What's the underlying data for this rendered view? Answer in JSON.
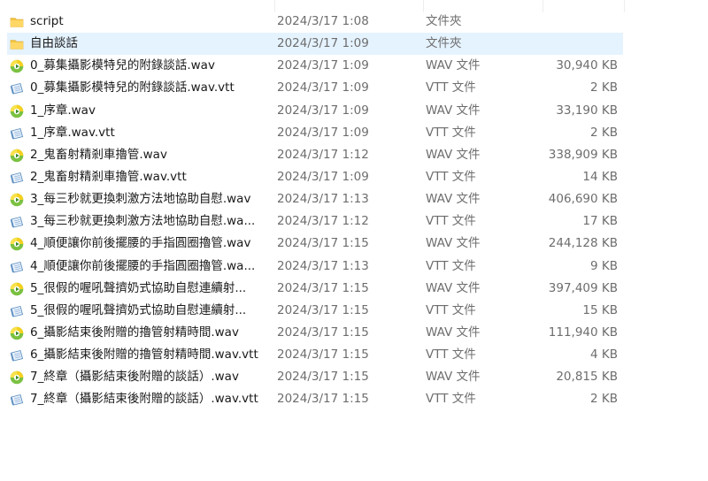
{
  "files": [
    {
      "name": "script",
      "date": "2024/3/17 1:08",
      "type": "文件夾",
      "size": "",
      "icon": "folder-icon"
    },
    {
      "name": "自由談話",
      "date": "2024/3/17 1:09",
      "type": "文件夾",
      "size": "",
      "icon": "folder-icon",
      "selected": true
    },
    {
      "name": "0_募集攝影模特兒的附錄談話.wav",
      "date": "2024/3/17 1:09",
      "type": "WAV 文件",
      "size": "30,940 KB",
      "icon": "audio-file-icon"
    },
    {
      "name": "0_募集攝影模特兒的附錄談話.wav.vtt",
      "date": "2024/3/17 1:09",
      "type": "VTT 文件",
      "size": "2 KB",
      "icon": "text-file-icon"
    },
    {
      "name": "1_序章.wav",
      "date": "2024/3/17 1:09",
      "type": "WAV 文件",
      "size": "33,190 KB",
      "icon": "audio-file-icon"
    },
    {
      "name": "1_序章.wav.vtt",
      "date": "2024/3/17 1:09",
      "type": "VTT 文件",
      "size": "2 KB",
      "icon": "text-file-icon"
    },
    {
      "name": "2_鬼畜射精剎車擼管.wav",
      "date": "2024/3/17 1:12",
      "type": "WAV 文件",
      "size": "338,909 KB",
      "icon": "audio-file-icon"
    },
    {
      "name": "2_鬼畜射精剎車擼管.wav.vtt",
      "date": "2024/3/17 1:09",
      "type": "VTT 文件",
      "size": "14 KB",
      "icon": "text-file-icon"
    },
    {
      "name": "3_每三秒就更換刺激方法地協助自慰.wav",
      "date": "2024/3/17 1:13",
      "type": "WAV 文件",
      "size": "406,690 KB",
      "icon": "audio-file-icon"
    },
    {
      "name": "3_每三秒就更換刺激方法地協助自慰.wa...",
      "date": "2024/3/17 1:12",
      "type": "VTT 文件",
      "size": "17 KB",
      "icon": "text-file-icon"
    },
    {
      "name": "4_順便讓你前後擺腰的手指圓圈擼管.wav",
      "date": "2024/3/17 1:15",
      "type": "WAV 文件",
      "size": "244,128 KB",
      "icon": "audio-file-icon"
    },
    {
      "name": "4_順便讓你前後擺腰的手指圓圈擼管.wa...",
      "date": "2024/3/17 1:13",
      "type": "VTT 文件",
      "size": "9 KB",
      "icon": "text-file-icon"
    },
    {
      "name": "5_很假的喔吼聲擠奶式協助自慰連續射...",
      "date": "2024/3/17 1:15",
      "type": "WAV 文件",
      "size": "397,409 KB",
      "icon": "audio-file-icon"
    },
    {
      "name": "5_很假的喔吼聲擠奶式協助自慰連續射...",
      "date": "2024/3/17 1:15",
      "type": "VTT 文件",
      "size": "15 KB",
      "icon": "text-file-icon"
    },
    {
      "name": "6_攝影結束後附贈的擼管射精時間.wav",
      "date": "2024/3/17 1:15",
      "type": "WAV 文件",
      "size": "111,940 KB",
      "icon": "audio-file-icon"
    },
    {
      "name": "6_攝影結束後附贈的擼管射精時間.wav.vtt",
      "date": "2024/3/17 1:15",
      "type": "VTT 文件",
      "size": "4 KB",
      "icon": "text-file-icon"
    },
    {
      "name": "7_終章（攝影結束後附贈的談話）.wav",
      "date": "2024/3/17 1:15",
      "type": "WAV 文件",
      "size": "20,815 KB",
      "icon": "audio-file-icon"
    },
    {
      "name": "7_終章（攝影結束後附贈的談話）.wav.vtt",
      "date": "2024/3/17 1:15",
      "type": "VTT 文件",
      "size": "2 KB",
      "icon": "text-file-icon"
    }
  ],
  "colors": {
    "selected_row": "#e5f3ff",
    "folder": "#f4c542",
    "audio_icon_green": "#7bc142",
    "audio_icon_yellow": "#f5d020",
    "text_icon": "#5a8dc0"
  }
}
